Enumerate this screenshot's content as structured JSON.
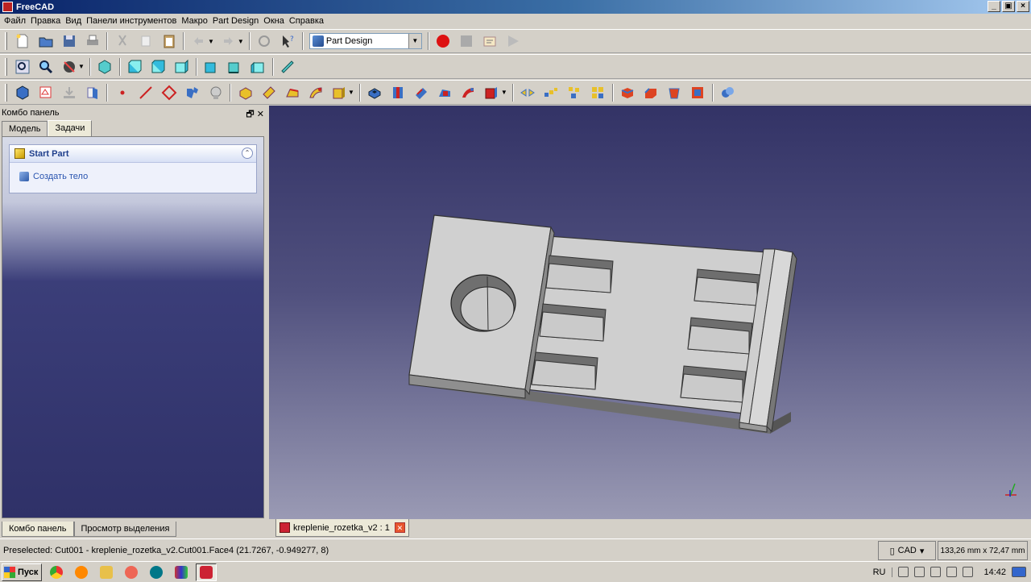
{
  "window": {
    "title": "FreeCAD",
    "buttons": [
      "_",
      "▣",
      "×"
    ]
  },
  "menu": [
    "Файл",
    "Правка",
    "Вид",
    "Панели инструментов",
    "Макро",
    "Part Design",
    "Окна",
    "Справка"
  ],
  "toolbar": {
    "workbench": "Part Design"
  },
  "combo": {
    "title": "Комбо панель",
    "tabs": [
      "Модель",
      "Задачи"
    ],
    "active_tab": "Задачи",
    "task_title": "Start Part",
    "task_action": "Создать тело",
    "bottom_tabs": [
      "Комбо панель",
      "Просмотр выделения"
    ]
  },
  "document": {
    "tab_label": "kreplenie_rozetka_v2 : 1"
  },
  "status": {
    "text": "Preselected: Cut001 - kreplenie_rozetka_v2.Cut001.Face4 (21.7267, -0.949277, 8)",
    "nav_style": "CAD",
    "dimensions": "133,26 mm x 72,47 mm"
  },
  "taskbar": {
    "start_label": "Пуск",
    "lang": "RU",
    "clock": "14:42"
  },
  "colors": {
    "accent": "#0a246a",
    "view_top": "#333366",
    "view_bottom": "#9a9ab4",
    "model_top": "#cccccc",
    "model_side": "#7a7a7a"
  },
  "icons": [
    "new-file-icon",
    "open-file-icon",
    "save-icon",
    "print-icon",
    "cut-icon",
    "copy-icon",
    "paste-icon",
    "undo-icon",
    "redo-icon",
    "refresh-icon",
    "whats-this-icon",
    "record-macro-icon",
    "stop-macro-icon",
    "edit-macro-icon",
    "run-macro-icon"
  ]
}
